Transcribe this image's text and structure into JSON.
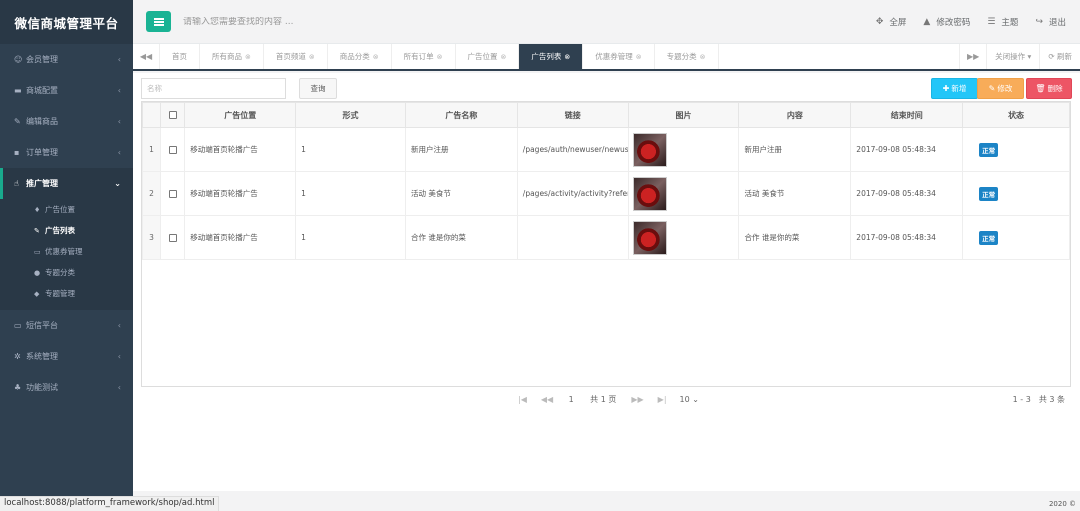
{
  "app": {
    "title": "微信商城管理平台"
  },
  "sidebar": {
    "items": [
      {
        "icon": "☺",
        "label": "会员管理",
        "arrow": "‹"
      },
      {
        "icon": "▬",
        "label": "商城配置",
        "arrow": "‹"
      },
      {
        "icon": "✎",
        "label": "编辑商品",
        "arrow": "‹"
      },
      {
        "icon": "▪",
        "label": "订单管理",
        "arrow": "‹"
      }
    ],
    "active_group": {
      "icon": "☝",
      "label": "推广管理",
      "arrow": "⌄"
    },
    "sub_items": [
      {
        "icon": "♦",
        "label": "广告位置"
      },
      {
        "icon": "✎",
        "label": "广告列表"
      },
      {
        "icon": "▭",
        "label": "优惠券管理"
      },
      {
        "icon": "●",
        "label": "专题分类"
      },
      {
        "icon": "◆",
        "label": "专题管理"
      }
    ],
    "items_after": [
      {
        "icon": "▭",
        "label": "短信平台",
        "arrow": "‹"
      },
      {
        "icon": "✲",
        "label": "系统管理",
        "arrow": "‹"
      },
      {
        "icon": "♣",
        "label": "功能测试",
        "arrow": "‹"
      }
    ]
  },
  "header": {
    "search_placeholder": "请输入您需要查找的内容 ...",
    "links": [
      {
        "icon": "✥",
        "label": "全屏"
      },
      {
        "icon": "▲",
        "label": "修改密码"
      },
      {
        "icon": "☰",
        "label": "主题"
      },
      {
        "icon": "↪",
        "label": "退出"
      }
    ]
  },
  "tabs": {
    "back_icon": "◀◀",
    "forward_icon": "▶▶",
    "items": [
      {
        "label": "首页",
        "closable": false
      },
      {
        "label": "所有商品",
        "closable": true
      },
      {
        "label": "首页频道",
        "closable": true
      },
      {
        "label": "商品分类",
        "closable": true
      },
      {
        "label": "所有订单",
        "closable": true
      },
      {
        "label": "广告位置",
        "closable": true
      },
      {
        "label": "广告列表",
        "closable": true,
        "active": true
      },
      {
        "label": "优惠券管理",
        "closable": true
      },
      {
        "label": "专题分类",
        "closable": true
      }
    ],
    "close_ops": "关闭操作 ▾",
    "refresh": "⟳ 刷新"
  },
  "toolbar": {
    "name_placeholder": "名称",
    "query_label": "查询",
    "add_label": "新增",
    "edit_label": "修改",
    "delete_label": "删除"
  },
  "table": {
    "columns": [
      "广告位置",
      "形式",
      "广告名称",
      "链接",
      "图片",
      "内容",
      "结束时间",
      "状态"
    ],
    "rows": [
      {
        "num": "1",
        "position": "移动端首页轮播广告",
        "form": "1",
        "name": "新用户注册",
        "link": "/pages/auth/newuser/newuser",
        "content": "新用户注册",
        "end_time": "2017-09-08 05:48:34",
        "status": "正常"
      },
      {
        "num": "2",
        "position": "移动端首页轮播广告",
        "form": "1",
        "name": "活动 美食节",
        "link": "/pages/activity/activity?refer",
        "content": "活动 美食节",
        "end_time": "2017-09-08 05:48:34",
        "status": "正常"
      },
      {
        "num": "3",
        "position": "移动端首页轮播广告",
        "form": "1",
        "name": "合作 谁是你的菜",
        "link": "",
        "content": "合作 谁是你的菜",
        "end_time": "2017-09-08 05:48:34",
        "status": "正常"
      }
    ]
  },
  "pager": {
    "page": "1",
    "total_pages": "共 1 页",
    "page_size": "10",
    "summary": "1 - 3　共 3 条"
  },
  "statusbar": {
    "url": "localhost:8088/platform_framework/shop/ad.html"
  },
  "footer": {
    "copyright": "2020 ©"
  },
  "colors": {
    "sidebar": "#2f4050",
    "accent": "#1ab394",
    "info": "#23c6f8",
    "warning": "#f8ac59",
    "danger": "#ed5565",
    "badge": "#1c84c6"
  }
}
